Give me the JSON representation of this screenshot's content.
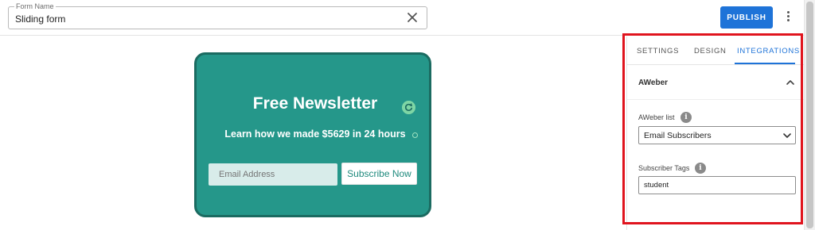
{
  "header": {
    "form_name_label": "Form Name",
    "form_name_value": "Sliding form",
    "publish_label": "PUBLISH"
  },
  "canvas": {
    "title": "Free Newsletter",
    "subtitle": "Learn how we made $5629 in 24 hours",
    "email_placeholder": "Email Address",
    "subscribe_label": "Subscribe Now",
    "card_color": "#25978a"
  },
  "panel": {
    "tabs": [
      {
        "label": "SETTINGS"
      },
      {
        "label": "DESIGN"
      },
      {
        "label": "INTEGRATIONS",
        "active": true
      }
    ],
    "section_title": "AWeber",
    "list_label": "AWeber list",
    "list_value": "Email Subscribers",
    "tags_label": "Subscriber Tags",
    "tags_value": "student"
  },
  "colors": {
    "accent": "#1e73d8",
    "highlight": "#e0141e"
  },
  "icons": [
    "clear-icon",
    "more-vertical-icon",
    "refresh-icon",
    "chevron-up-icon",
    "chevron-down-icon",
    "info-icon"
  ]
}
